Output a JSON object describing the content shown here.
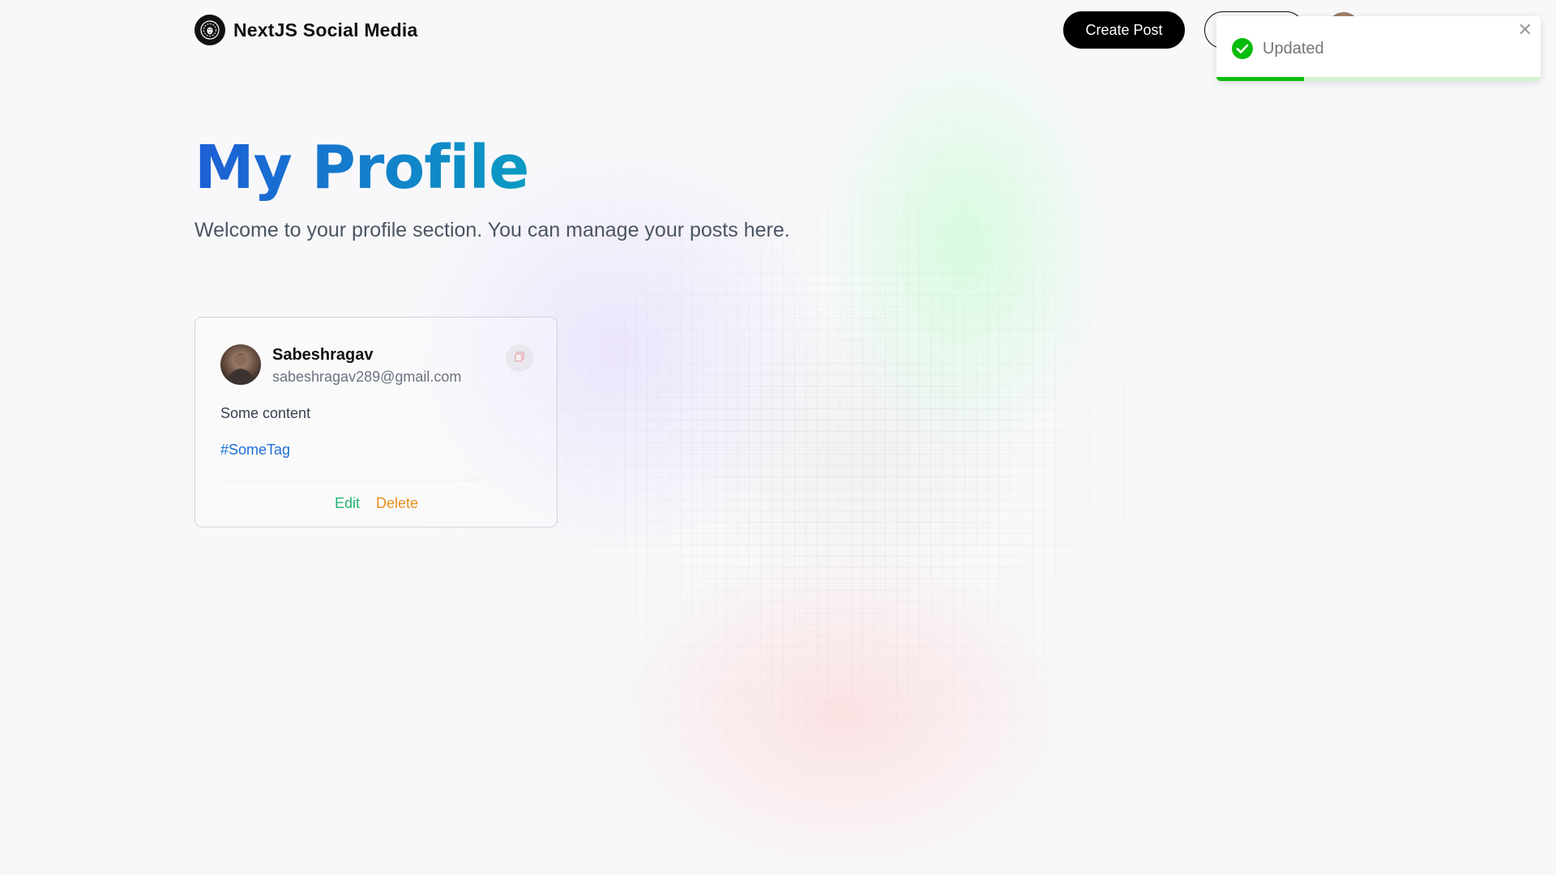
{
  "brand": {
    "name": "NextJS Social Media",
    "logo_icon": "lion-logo-icon"
  },
  "nav": {
    "create_post_label": "Create Post",
    "outline_button_label": "",
    "avatar": "user-avatar"
  },
  "toast": {
    "message": "Updated",
    "icon": "check-circle-icon",
    "close_icon": "close-icon",
    "close_glyph": "✕",
    "progress": 0.27,
    "accent_color": "#07bc0c"
  },
  "header": {
    "title": "My Profile",
    "description": "Welcome to your profile section. You can manage your posts here."
  },
  "posts": [
    {
      "username": "Sabeshragav",
      "email": "sabeshragav289@gmail.com",
      "content": "Some content",
      "tag": "#SomeTag",
      "edit_label": "Edit",
      "delete_label": "Delete",
      "copy_icon": "copy-icon"
    }
  ],
  "colors": {
    "title_gradient_start": "#1d5fd6",
    "title_gradient_end": "#0a9bc2",
    "tag": "#1d6fd6",
    "edit": "#22b473",
    "delete": "#e88d1a"
  }
}
